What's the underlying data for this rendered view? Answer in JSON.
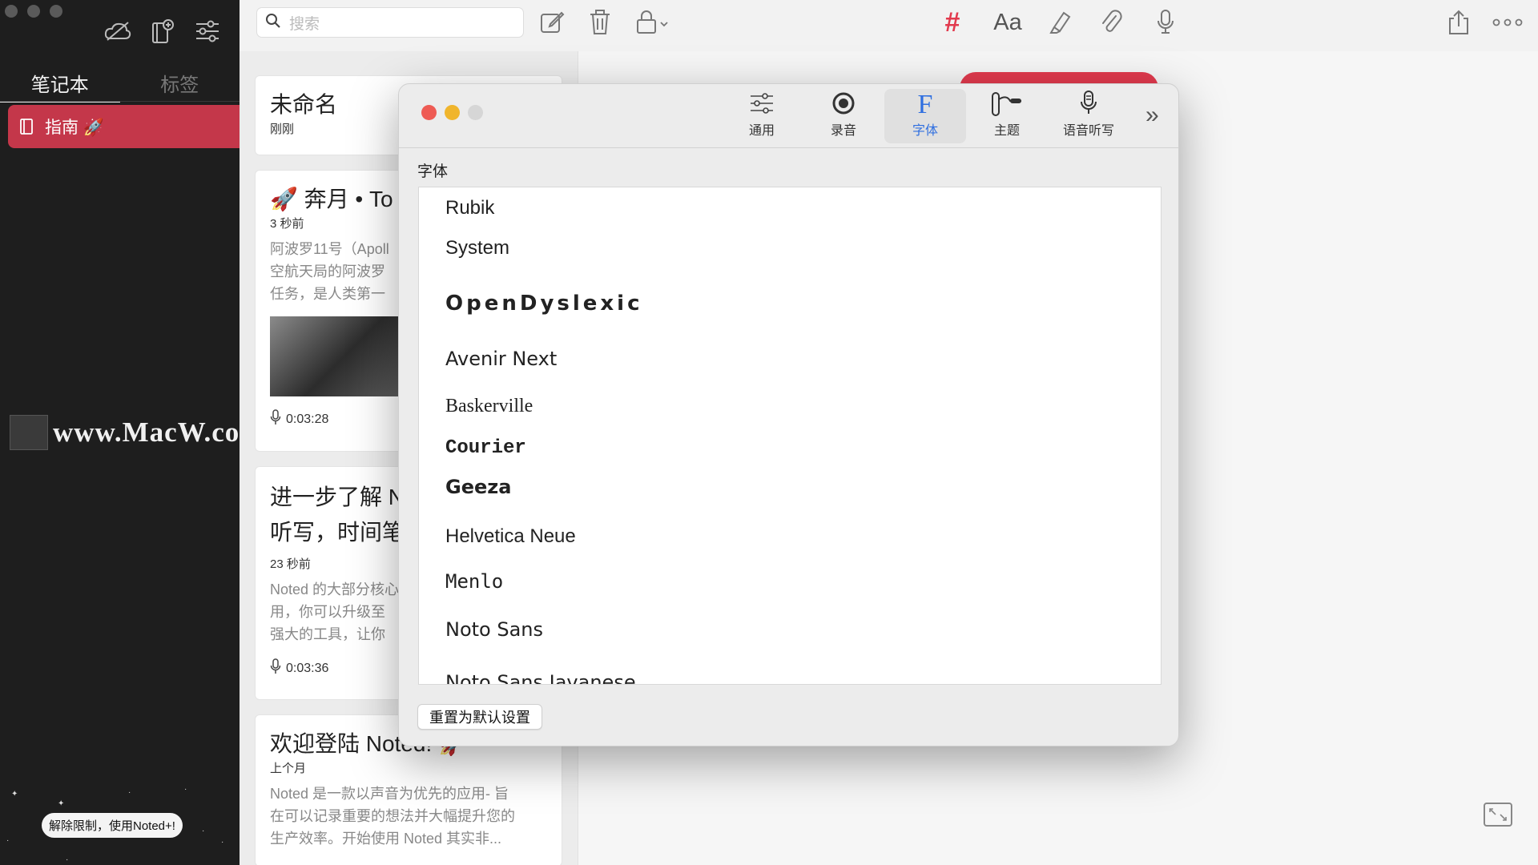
{
  "sidebar": {
    "tabs": [
      {
        "label": "笔记本",
        "active": true
      },
      {
        "label": "标签",
        "active": false
      }
    ],
    "selected_notebook": "指南 🚀",
    "watermark": "www.MacW.com",
    "upgrade_label": "解除限制，使用Noted+!"
  },
  "toolbar": {
    "search_placeholder": "搜索",
    "tag_symbol": "#",
    "font_symbol": "Aa"
  },
  "notes": [
    {
      "title": "未命名",
      "time": "刚刚"
    },
    {
      "title": "🚀 奔月 • To",
      "time": "3 秒前",
      "preview": [
        "阿波罗11号（Apoll",
        "空航天局的阿波罗",
        "任务，是人类第一"
      ],
      "audio": "0:03:28"
    },
    {
      "title": "进一步了解 N",
      "title2": "听写，时间笔",
      "time": "23 秒前",
      "preview": [
        "Noted 的大部分核心",
        "用，你可以升级至",
        "强大的工具，让你"
      ],
      "audio": "0:03:36"
    },
    {
      "title": "欢迎登陆 Noted! 🚀",
      "time": "上个月",
      "preview": [
        "Noted 是一款以声音为优先的应用- 旨",
        "在可以记录重要的想法并大幅提升您的",
        "生产效率。开始使用 Noted 其实非..."
      ]
    }
  ],
  "dialog": {
    "tabs": [
      {
        "label": "通用",
        "icon": "sliders-icon",
        "active": false
      },
      {
        "label": "录音",
        "icon": "record-icon",
        "active": false
      },
      {
        "label": "字体",
        "icon": "font-icon",
        "active": true
      },
      {
        "label": "主题",
        "icon": "paint-roller-icon",
        "active": false
      },
      {
        "label": "语音听写",
        "icon": "microphone-icon",
        "active": false
      }
    ],
    "section_label": "字体",
    "fonts": [
      "Rubik",
      "System",
      "OpenDyslexic",
      "Avenir Next",
      "Baskerville",
      "Courier",
      "Geeza",
      "Helvetica Neue",
      "Menlo",
      "Noto Sans",
      "Noto Sans Javanese"
    ],
    "reset_label": "重置为默认设置"
  },
  "colors": {
    "accent": "#e23a4e",
    "sidebar_bg": "#1e1e1e",
    "active_tab_text": "#2f6fe0"
  }
}
